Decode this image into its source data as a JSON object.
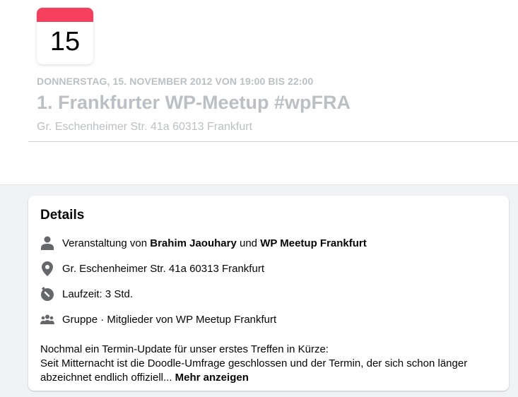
{
  "event": {
    "day": "15",
    "date_line": "DONNERSTAG, 15. NOVEMBER 2012 VON 19:00 BIS 22:00",
    "title": "1. Frankfurter WP-Meetup #wpFRA",
    "address": "Gr. Eschenheimer Str. 41a 60313 Frankfurt"
  },
  "details": {
    "heading": "Details",
    "host_prefix": "Veranstaltung von ",
    "host1": "Brahim Jaouhary",
    "host_mid": " und ",
    "host2": "WP Meetup Frankfurt",
    "location": "Gr. Eschenheimer Str. 41a 60313 Frankfurt",
    "duration": "Laufzeit: 3 Std.",
    "audience": "Gruppe · Mitglieder von WP Meetup Frankfurt",
    "description_line1": "Nochmal ein Termin-Update für unser erstes Treffen in Kürze:",
    "description_line2": "Seit Mitternacht ist die Doodle-Umfrage geschlossen und der Termin, der sich schon länger abzeichnet endlich offiziell... ",
    "more_label": "Mehr anzeigen"
  },
  "colors": {
    "accent": "#f43f5e",
    "icon": "#65676b",
    "muted": "#bcc0c4"
  }
}
